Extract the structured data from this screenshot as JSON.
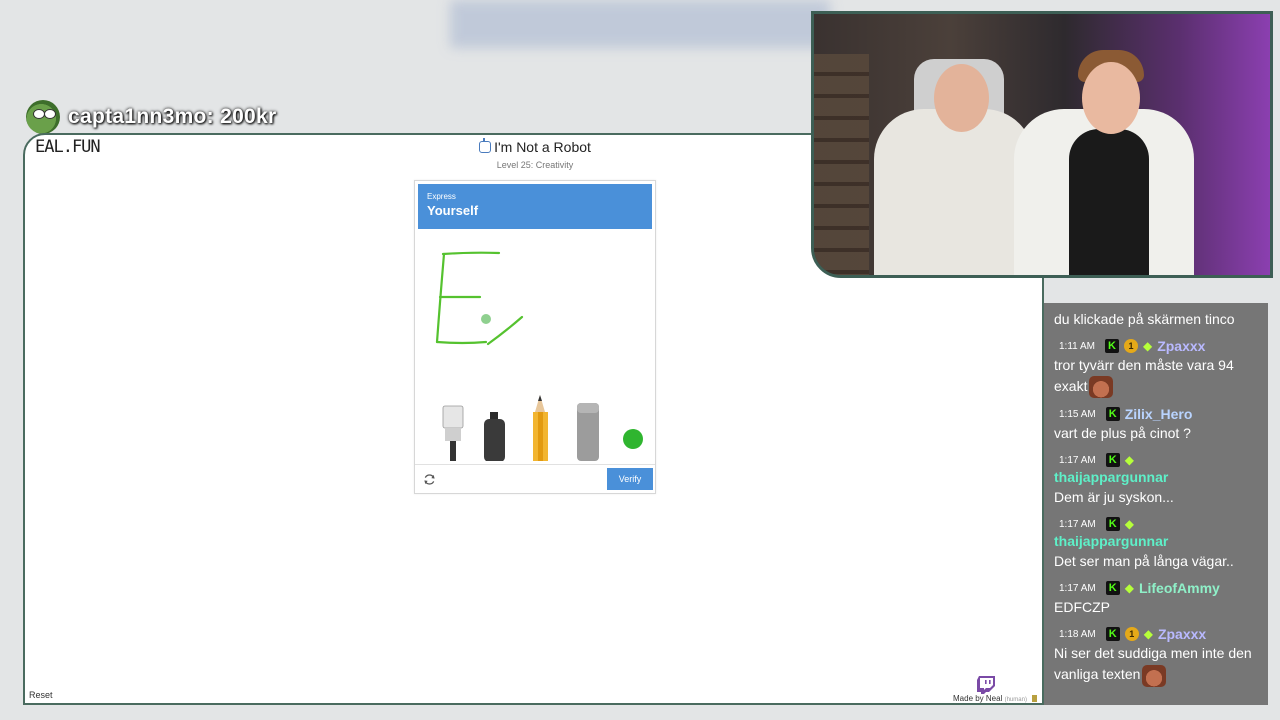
{
  "donation": {
    "text": "capta1nn3mo: 200kr"
  },
  "site": {
    "logo": "EAL.FUN",
    "title": "I'm Not a Robot",
    "subtitle": "Level 25: Creativity",
    "reset": "Reset",
    "made_by": "Made by Neal",
    "made_by_tag": "(human)"
  },
  "captcha": {
    "header_small": "Express",
    "header_big": "Yourself",
    "tools": [
      "brush-icon",
      "spray-can-icon",
      "pencil-icon",
      "eraser-icon",
      "color-dot-icon"
    ],
    "active_color": "#2fb52f",
    "verify_label": "Verify"
  },
  "colors": {
    "accent": "#4a90d9",
    "chat_bg": "#767676",
    "frame": "#4a6b5f"
  },
  "chat": {
    "partial_message": "du klickade på skärmen tinco",
    "messages": [
      {
        "time": "1:11 AM",
        "badges": [
          "k",
          "coin",
          "gem"
        ],
        "coin_count": "1",
        "user": "Zpaxxx",
        "user_color": "#b9b9ff",
        "text": "tror tyvärr den måste vara 94 exakt",
        "emote": true
      },
      {
        "time": "1:15 AM",
        "badges": [
          "k"
        ],
        "user": "Zilix_Hero",
        "user_color": "#b9d4ff",
        "text": "vart de plus på cinot ?",
        "emote": false
      },
      {
        "time": "1:17 AM",
        "badges": [
          "k",
          "gem"
        ],
        "user": "thaijappargunnar",
        "user_color": "#5ef0c8",
        "text": "Dem är ju syskon...",
        "emote": false
      },
      {
        "time": "1:17 AM",
        "badges": [
          "k",
          "gem"
        ],
        "user": "thaijappargunnar",
        "user_color": "#5ef0c8",
        "text": "Det ser man på långa vägar..",
        "emote": false
      },
      {
        "time": "1:17 AM",
        "badges": [
          "k",
          "gem"
        ],
        "user": "LifeofAmmy",
        "user_color": "#8ff0c8",
        "text": "EDFCZP",
        "emote": false
      },
      {
        "time": "1:18 AM",
        "badges": [
          "k",
          "coin",
          "gem"
        ],
        "coin_count": "1",
        "user": "Zpaxxx",
        "user_color": "#b9b9ff",
        "text": "Ni ser det suddiga men inte den vanliga texten",
        "emote": true
      }
    ]
  }
}
